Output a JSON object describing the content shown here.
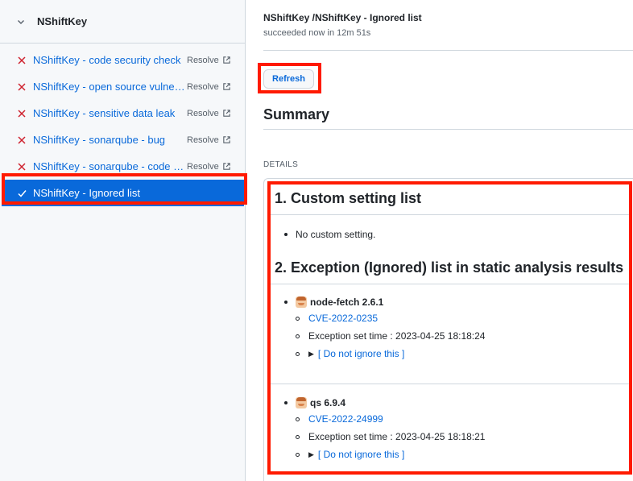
{
  "sidebar": {
    "workflow_name": "NShiftKey",
    "jobs": [
      {
        "name": "NShiftKey - code security check",
        "status": "failed",
        "resolve": "Resolve"
      },
      {
        "name": "NShiftKey - open source vulnerabilities",
        "status": "failed",
        "resolve": "Resolve"
      },
      {
        "name": "NShiftKey - sensitive data leak",
        "status": "failed",
        "resolve": "Resolve"
      },
      {
        "name": "NShiftKey - sonarqube - bug",
        "status": "failed",
        "resolve": "Resolve"
      },
      {
        "name": "NShiftKey - sonarqube - code smell",
        "status": "failed",
        "resolve": "Resolve"
      },
      {
        "name": "NShiftKey - Ignored list",
        "status": "success",
        "resolve": ""
      }
    ]
  },
  "main": {
    "title": "NShiftKey /NShiftKey - Ignored list",
    "subtitle": "succeeded now in 12m 51s",
    "refresh_label": "Refresh",
    "summary_heading": "Summary",
    "details_label": "DETAILS",
    "section1_heading": "1. Custom setting list",
    "section1_item": "No custom setting.",
    "section2_heading": "2. Exception (Ignored) list in static analysis results",
    "packages": [
      {
        "name": "node-fetch 2.6.1",
        "cve": "CVE-2022-0235",
        "exception_time": "Exception set time : 2023-04-25 18:18:24",
        "toggle": "[ Do not ignore this ]"
      },
      {
        "name": "qs 6.9.4",
        "cve": "CVE-2022-24999",
        "exception_time": "Exception set time : 2023-04-25 18:18:21",
        "toggle": "[ Do not ignore this ]"
      }
    ]
  },
  "colors": {
    "accent": "#0969da",
    "fail": "#cf222e",
    "highlight": "#ff1a00"
  }
}
